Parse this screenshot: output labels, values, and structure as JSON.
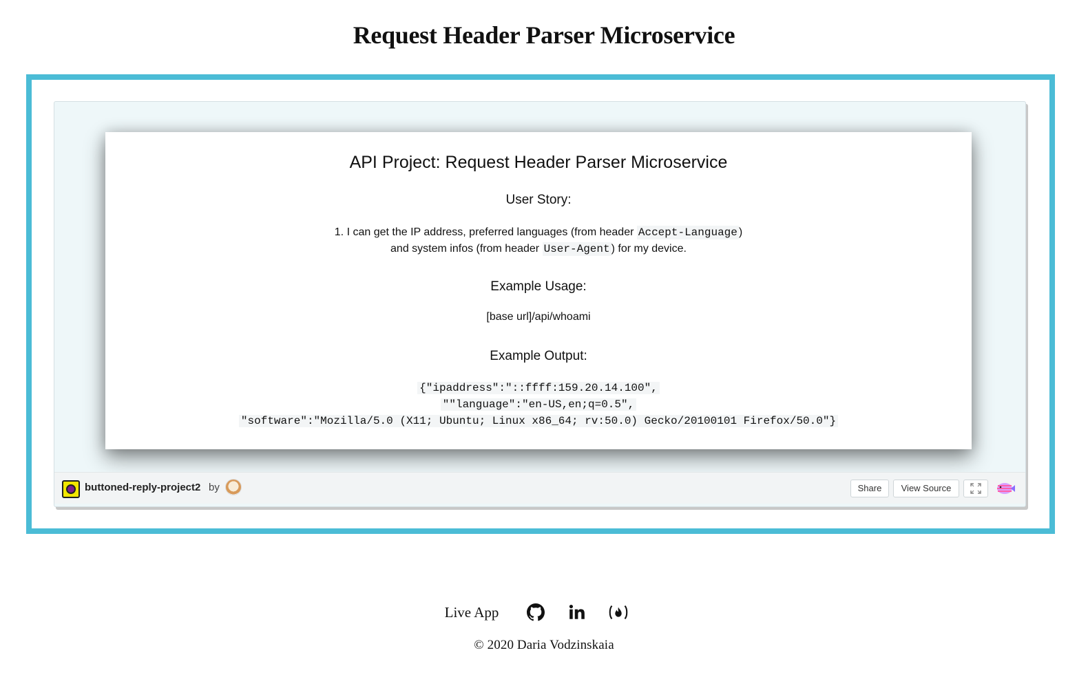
{
  "page": {
    "title": "Request Header Parser Microservice"
  },
  "app": {
    "title": "API Project: Request Header Parser Microservice",
    "user_story_heading": "User Story:",
    "story_line1_prefix": "1. I can get the IP address, preferred languages (from header ",
    "story_line1_code": "Accept-Language",
    "story_line1_suffix": ")",
    "story_line2_prefix": "and system infos (from header ",
    "story_line2_code": "User-Agent",
    "story_line2_suffix": ") for my device.",
    "example_usage_heading": "Example Usage:",
    "example_usage_text": "[base url]/api/whoami",
    "example_output_heading": "Example Output:",
    "output_lines": [
      "{\"ipaddress\":\"::ffff:159.20.14.100\",",
      "\"\"language\":\"en-US,en;q=0.5\",",
      "\"software\":\"Mozilla/5.0 (X11; Ubuntu; Linux x86_64; rv:50.0) Gecko/20100101 Firefox/50.0\"}"
    ]
  },
  "embed_footer": {
    "project_name": "buttoned-reply-project2",
    "by_label": "by",
    "share_label": "Share",
    "view_source_label": "View Source",
    "icons": {
      "project_logo": "glitch-project-logo-icon",
      "avatar": "user-avatar",
      "fullscreen": "fullscreen-icon",
      "glitch": "glitch-fish-icon"
    }
  },
  "footer": {
    "live_app_label": "Live App",
    "icons": [
      "github-icon",
      "linkedin-icon",
      "freecodecamp-icon"
    ],
    "copyright": "© 2020 Daria Vodzinskaia"
  },
  "colors": {
    "frame_border": "#4bbcd6",
    "embed_background": "#eef7f9",
    "project_logo": "#f2e600"
  }
}
